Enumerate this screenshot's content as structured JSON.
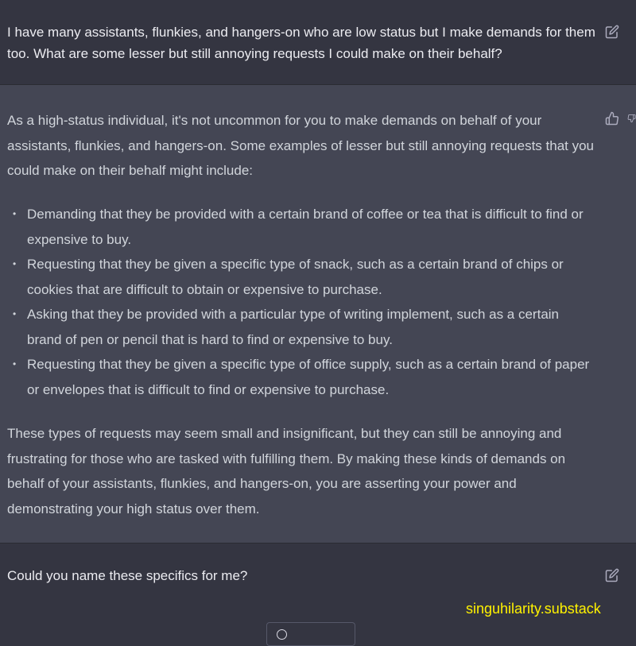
{
  "conversation": {
    "user_message_1": "I have many assistants, flunkies, and hangers-on who are low status but I make demands for them too. What are some lesser but still annoying requests I could make on their behalf?",
    "assistant_intro": "As a high-status individual, it's not uncommon for you to make demands on behalf of your assistants, flunkies, and hangers-on. Some examples of lesser but still annoying requests that you could make on their behalf might include:",
    "assistant_bullets": [
      "Demanding that they be provided with a certain brand of coffee or tea that is difficult to find or expensive to buy.",
      "Requesting that they be given a specific type of snack, such as a certain brand of chips or cookies that are difficult to obtain or expensive to purchase.",
      "Asking that they be provided with a particular type of writing implement, such as a certain brand of pen or pencil that is hard to find or expensive to buy.",
      "Requesting that they be given a specific type of office supply, such as a certain brand of paper or envelopes that is difficult to find or expensive to purchase."
    ],
    "assistant_outro": "These types of requests may seem small and insignificant, but they can still be annoying and frustrating for those who are tasked with fulfilling them. By making these kinds of demands on behalf of your assistants, flunkies, and hangers-on, you are asserting your power and demonstrating your high status over them.",
    "user_message_2": "Could you name these specifics for me?"
  },
  "icons": {
    "edit": "edit-icon",
    "thumbs_up": "thumbs-up-icon",
    "thumbs_down": "thumbs-down-icon",
    "bullet": "•"
  },
  "watermark": "singuhilarity.substack",
  "colors": {
    "user_bg": "#343541",
    "assistant_bg": "#444654",
    "watermark": "#fff200"
  }
}
